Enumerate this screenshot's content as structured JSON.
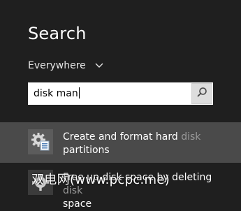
{
  "panel": {
    "title": "Search",
    "scope_label": "Everywhere"
  },
  "search": {
    "query": "disk man"
  },
  "results": [
    {
      "line1_main": "Create and format hard ",
      "line1_dim": "disk",
      "line2": "partitions",
      "icon": "disk-management-gear-icon"
    },
    {
      "line1_main": "Free up disk space by deleting",
      "line1_dim": "disk",
      "line2": "space",
      "icon": "gear-icon"
    }
  ],
  "watermark": {
    "text": "双电网(www.pcpc.me)"
  },
  "colors": {
    "background": "#1f1f1f",
    "selected_row": "#4a4a4a",
    "search_box": "#ffffff",
    "search_button": "#dddddd",
    "dim_text": "#9a9a9a"
  }
}
